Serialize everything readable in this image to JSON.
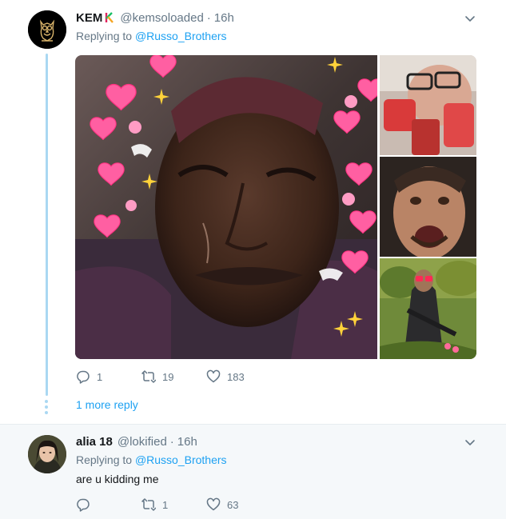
{
  "tweets": [
    {
      "name": "KEM",
      "handle": "@kemsoloaded",
      "separator": "·",
      "time": "16h",
      "replying_prefix": "Replying to ",
      "replying_to": "@Russo_Brothers",
      "avatar_icon": "owl-logo-icon",
      "stats": {
        "replies": "1",
        "retweets": "19",
        "likes": "183"
      },
      "more_replies": "1 more reply"
    },
    {
      "name": "alia 18",
      "handle": "@lokified",
      "separator": "·",
      "time": "16h",
      "replying_prefix": "Replying to ",
      "replying_to": "@Russo_Brothers",
      "avatar_icon": "profile-photo",
      "text": "are u kidding me",
      "stats": {
        "replies": "",
        "retweets": "1",
        "likes": "63"
      }
    }
  ],
  "colors": {
    "link": "#1da1f2",
    "muted": "#657786",
    "thread_line": "#aad8f2",
    "reply_bg": "#f5f8fa"
  }
}
